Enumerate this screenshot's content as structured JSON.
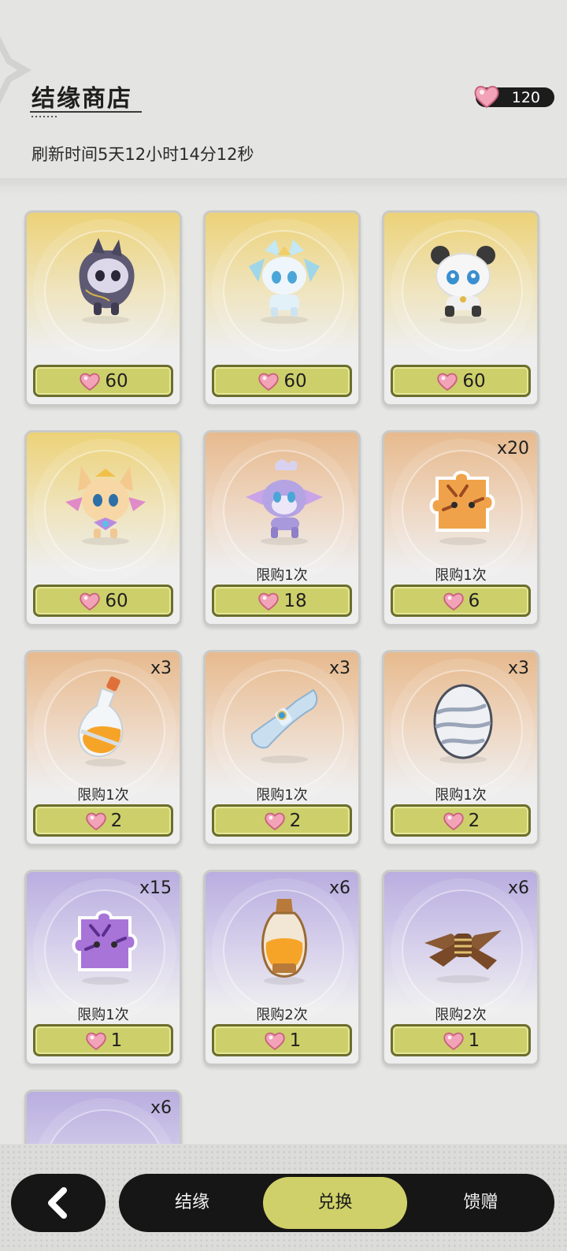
{
  "header": {
    "title": "结缘商店",
    "currency_amount": "120",
    "refresh_text": "刷新时间5天12小时14分12秒"
  },
  "items": [
    {
      "rarity": "gold",
      "icon": "dark-cat-pet-icon",
      "qty": "",
      "limit": "",
      "price": "60"
    },
    {
      "rarity": "gold",
      "icon": "ice-crystal-pet-icon",
      "qty": "",
      "limit": "",
      "price": "60"
    },
    {
      "rarity": "gold",
      "icon": "panda-pet-icon",
      "qty": "",
      "limit": "",
      "price": "60"
    },
    {
      "rarity": "gold",
      "icon": "fox-pet-icon",
      "qty": "",
      "limit": "",
      "price": "60"
    },
    {
      "rarity": "orange",
      "icon": "purple-deer-pet-icon",
      "qty": "",
      "limit": "限购1次",
      "price": "18"
    },
    {
      "rarity": "orange",
      "icon": "tiger-puzzle-piece-icon",
      "qty": "x20",
      "limit": "限购1次",
      "price": "6"
    },
    {
      "rarity": "orange",
      "icon": "potion-bottle-icon",
      "qty": "x3",
      "limit": "限购1次",
      "price": "2"
    },
    {
      "rarity": "orange",
      "icon": "scroll-icon",
      "qty": "x3",
      "limit": "限购1次",
      "price": "2"
    },
    {
      "rarity": "orange",
      "icon": "egg-icon",
      "qty": "x3",
      "limit": "限购1次",
      "price": "2"
    },
    {
      "rarity": "purple",
      "icon": "purple-puzzle-piece-icon",
      "qty": "x15",
      "limit": "限购1次",
      "price": "1"
    },
    {
      "rarity": "purple",
      "icon": "lantern-bottle-icon",
      "qty": "x6",
      "limit": "限购2次",
      "price": "1"
    },
    {
      "rarity": "purple",
      "icon": "wood-bundle-icon",
      "qty": "x6",
      "limit": "限购2次",
      "price": "1"
    },
    {
      "rarity": "purple",
      "icon": "partial-item-icon",
      "qty": "x6",
      "limit": "",
      "price": ""
    }
  ],
  "nav": {
    "tabs": [
      "结缘",
      "兑换",
      "馈赠"
    ],
    "active_index": 1
  },
  "colors": {
    "accent": "#cfd069",
    "dark": "#161616",
    "price_button": "#cdcf6a"
  }
}
